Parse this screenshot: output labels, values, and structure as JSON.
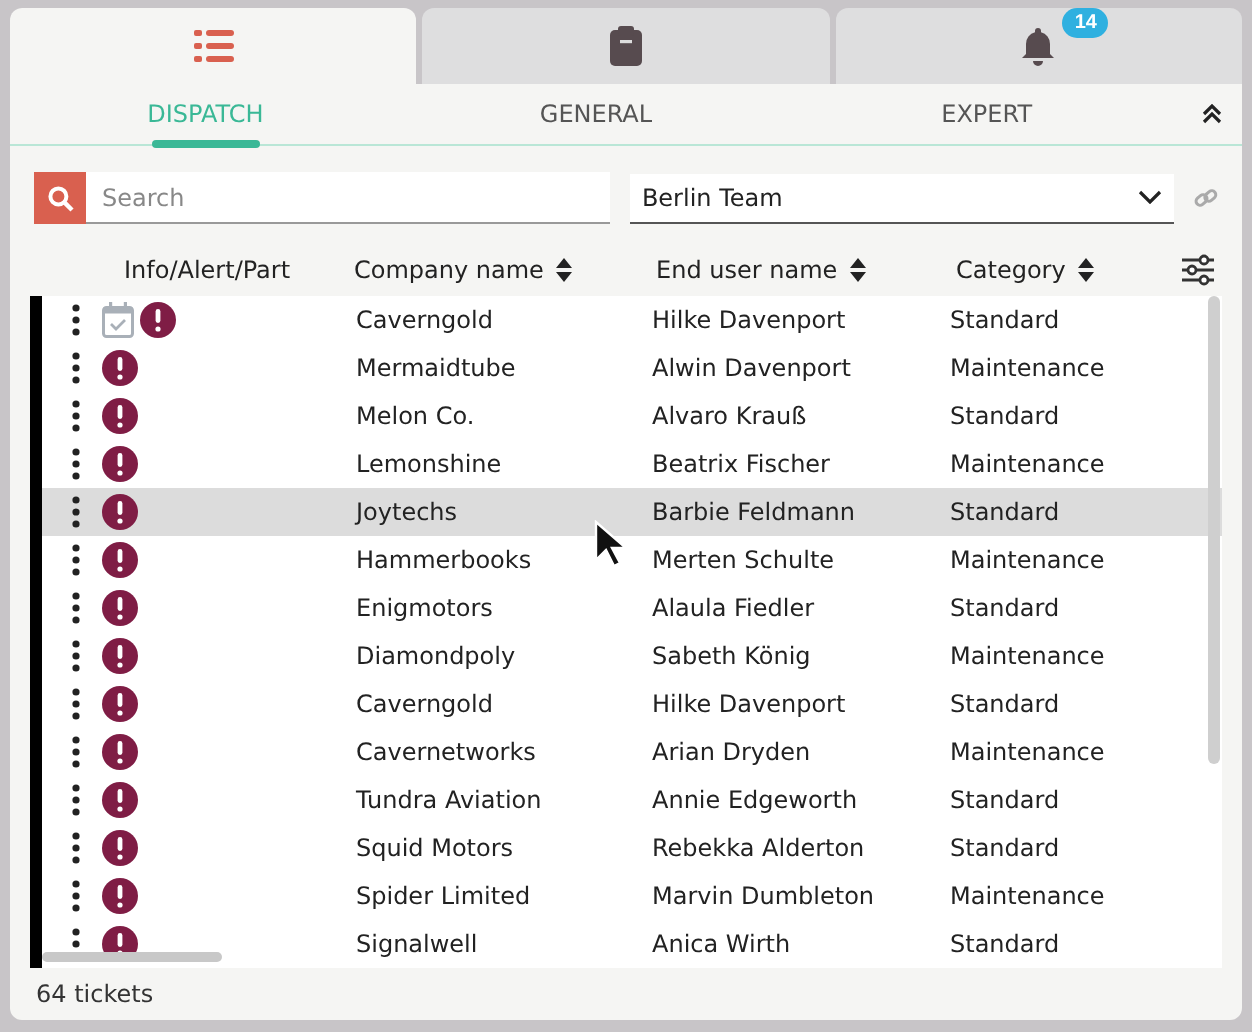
{
  "top_tabs": [
    {
      "kind": "list",
      "selected": true
    },
    {
      "kind": "clipboard",
      "selected": false
    },
    {
      "kind": "bell",
      "selected": false,
      "badge": "14"
    }
  ],
  "sub_tabs": [
    {
      "label": "DISPATCH",
      "selected": true
    },
    {
      "label": "GENERAL",
      "selected": false
    },
    {
      "label": "EXPERT",
      "selected": false
    }
  ],
  "search": {
    "placeholder": "Search"
  },
  "team_select": {
    "value": "Berlin Team"
  },
  "table": {
    "columns": [
      "Info/Alert/Part",
      "Company name",
      "End user name",
      "Category"
    ],
    "rows": [
      {
        "company": "Caverngold",
        "end_user": "Hilke Davenport",
        "category": "Standard",
        "scheduled": true,
        "hovered": false
      },
      {
        "company": "Mermaidtube",
        "end_user": "Alwin Davenport",
        "category": "Maintenance",
        "scheduled": false,
        "hovered": false
      },
      {
        "company": "Melon Co.",
        "end_user": "Alvaro Krauß",
        "category": "Standard",
        "scheduled": false,
        "hovered": false
      },
      {
        "company": "Lemonshine",
        "end_user": "Beatrix Fischer",
        "category": "Maintenance",
        "scheduled": false,
        "hovered": false
      },
      {
        "company": "Joytechs",
        "end_user": "Barbie Feldmann",
        "category": "Standard",
        "scheduled": false,
        "hovered": true
      },
      {
        "company": "Hammerbooks",
        "end_user": "Merten Schulte",
        "category": "Maintenance",
        "scheduled": false,
        "hovered": false
      },
      {
        "company": "Enigmotors",
        "end_user": "Alaula Fiedler",
        "category": "Standard",
        "scheduled": false,
        "hovered": false
      },
      {
        "company": "Diamondpoly",
        "end_user": "Sabeth König",
        "category": "Maintenance",
        "scheduled": false,
        "hovered": false
      },
      {
        "company": "Caverngold",
        "end_user": "Hilke Davenport",
        "category": "Standard",
        "scheduled": false,
        "hovered": false
      },
      {
        "company": "Cavernetworks",
        "end_user": "Arian Dryden",
        "category": "Maintenance",
        "scheduled": false,
        "hovered": false
      },
      {
        "company": "Tundra Aviation",
        "end_user": "Annie Edgeworth",
        "category": "Standard",
        "scheduled": false,
        "hovered": false
      },
      {
        "company": "Squid Motors",
        "end_user": "Rebekka Alderton",
        "category": "Standard",
        "scheduled": false,
        "hovered": false
      },
      {
        "company": "Spider Limited",
        "end_user": "Marvin Dumbleton",
        "category": "Maintenance",
        "scheduled": false,
        "hovered": false
      },
      {
        "company": "Signalwell",
        "end_user": "Anica Wirth",
        "category": "Standard",
        "scheduled": false,
        "hovered": false
      }
    ]
  },
  "status_bar": {
    "count": "64 tickets"
  }
}
